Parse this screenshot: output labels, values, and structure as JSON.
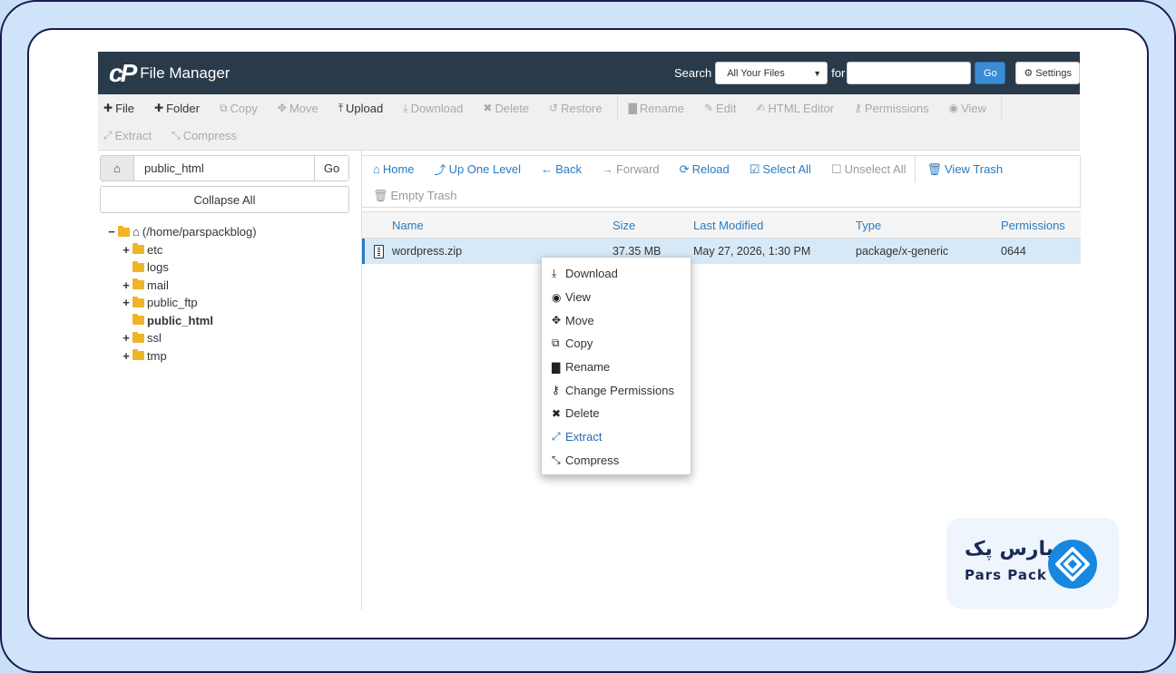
{
  "header": {
    "app_title": "File Manager",
    "search_label": "Search",
    "search_scope": "All Your Files",
    "for_label": "for",
    "search_value": "",
    "go_label": "Go",
    "settings_label": "Settings"
  },
  "toolbar": {
    "row1": [
      {
        "label": "File",
        "icon": "plus-icon",
        "glyph": "✚",
        "enabled": true
      },
      {
        "label": "Folder",
        "icon": "plus-icon",
        "glyph": "✚",
        "enabled": true
      },
      {
        "label": "Copy",
        "icon": "copy-icon",
        "glyph": "⧉",
        "enabled": false
      },
      {
        "label": "Move",
        "icon": "move-icon",
        "glyph": "✥",
        "enabled": false
      },
      {
        "label": "Upload",
        "icon": "upload-icon",
        "glyph": "⤒",
        "enabled": true
      },
      {
        "label": "Download",
        "icon": "download-icon",
        "glyph": "⤓",
        "enabled": false
      },
      {
        "label": "Delete",
        "icon": "close-icon",
        "glyph": "✖",
        "enabled": false
      },
      {
        "label": "Restore",
        "icon": "undo-icon",
        "glyph": "↺",
        "enabled": false
      },
      {
        "label": "Rename",
        "icon": "file-icon",
        "glyph": "▇",
        "enabled": false
      },
      {
        "label": "Edit",
        "icon": "pencil-icon",
        "glyph": "✎",
        "enabled": false
      },
      {
        "label": "HTML Editor",
        "icon": "edit-square-icon",
        "glyph": "✍",
        "enabled": false
      },
      {
        "label": "Permissions",
        "icon": "key-icon",
        "glyph": "⚷",
        "enabled": false
      },
      {
        "label": "View",
        "icon": "eye-icon",
        "glyph": "◉",
        "enabled": false
      }
    ],
    "row2": [
      {
        "label": "Extract",
        "icon": "expand-icon",
        "glyph": "⤢",
        "enabled": false
      },
      {
        "label": "Compress",
        "icon": "compress-icon",
        "glyph": "⤡",
        "enabled": false
      }
    ]
  },
  "left": {
    "path_value": "public_html",
    "path_go": "Go",
    "collapse_label": "Collapse All",
    "tree": [
      {
        "toggle": "−",
        "label": "(/home/parspackblog)",
        "root": true,
        "bold": false,
        "indent": 0
      },
      {
        "toggle": "+",
        "label": "etc",
        "root": false,
        "bold": false,
        "indent": 1
      },
      {
        "toggle": "",
        "label": "logs",
        "root": false,
        "bold": false,
        "indent": 1
      },
      {
        "toggle": "+",
        "label": "mail",
        "root": false,
        "bold": false,
        "indent": 1
      },
      {
        "toggle": "+",
        "label": "public_ftp",
        "root": false,
        "bold": false,
        "indent": 1
      },
      {
        "toggle": "",
        "label": "public_html",
        "root": false,
        "bold": true,
        "indent": 1
      },
      {
        "toggle": "+",
        "label": "ssl",
        "root": false,
        "bold": false,
        "indent": 1
      },
      {
        "toggle": "+",
        "label": "tmp",
        "root": false,
        "bold": false,
        "indent": 1
      }
    ]
  },
  "nav": {
    "row1": [
      {
        "label": "Home",
        "icon": "home-icon",
        "glyph": "⌂",
        "enabled": true
      },
      {
        "label": "Up One Level",
        "icon": "level-up-icon",
        "glyph": "⤴",
        "enabled": true
      },
      {
        "label": "Back",
        "icon": "arrow-left-icon",
        "glyph": "←",
        "enabled": true
      },
      {
        "label": "Forward",
        "icon": "arrow-right-icon",
        "glyph": "→",
        "enabled": false
      },
      {
        "label": "Reload",
        "icon": "refresh-icon",
        "glyph": "⟳",
        "enabled": true
      },
      {
        "label": "Select All",
        "icon": "checkbox-checked-icon",
        "glyph": "☑",
        "enabled": true
      },
      {
        "label": "Unselect All",
        "icon": "checkbox-empty-icon",
        "glyph": "☐",
        "enabled": false
      },
      {
        "label": "View Trash",
        "icon": "trash-icon",
        "glyph": "🗑",
        "enabled": true
      }
    ],
    "row2": [
      {
        "label": "Empty Trash",
        "icon": "trash-icon",
        "glyph": "🗑",
        "enabled": false
      }
    ]
  },
  "table": {
    "headers": {
      "name": "Name",
      "size": "Size",
      "modified": "Last Modified",
      "type": "Type",
      "perms": "Permissions"
    },
    "rows": [
      {
        "name": "wordpress.zip",
        "size": "37.35 MB",
        "modified": "May 27, 2026, 1:30 PM",
        "type": "package/x-generic",
        "perms": "0644"
      }
    ]
  },
  "context_menu": [
    {
      "label": "Download",
      "icon": "download-icon",
      "glyph": "⤓",
      "highlight": false
    },
    {
      "label": "View",
      "icon": "eye-icon",
      "glyph": "◉",
      "highlight": false
    },
    {
      "label": "Move",
      "icon": "move-icon",
      "glyph": "✥",
      "highlight": false
    },
    {
      "label": "Copy",
      "icon": "copy-icon",
      "glyph": "⧉",
      "highlight": false
    },
    {
      "label": "Rename",
      "icon": "file-icon",
      "glyph": "▇",
      "highlight": false
    },
    {
      "label": "Change Permissions",
      "icon": "key-icon",
      "glyph": "⚷",
      "highlight": false
    },
    {
      "label": "Delete",
      "icon": "close-icon",
      "glyph": "✖",
      "highlight": false
    },
    {
      "label": "Extract",
      "icon": "expand-icon",
      "glyph": "⤢",
      "highlight": true
    },
    {
      "label": "Compress",
      "icon": "compress-icon",
      "glyph": "⤡",
      "highlight": false
    }
  ],
  "brand": {
    "name_fa": "پارس پک",
    "name_en": "Pars Pack",
    "color": "#1787e0"
  },
  "colors": {
    "header_bg": "#293a4a",
    "accent": "#2a7ac0",
    "row_selected": "#d6e9f8"
  }
}
